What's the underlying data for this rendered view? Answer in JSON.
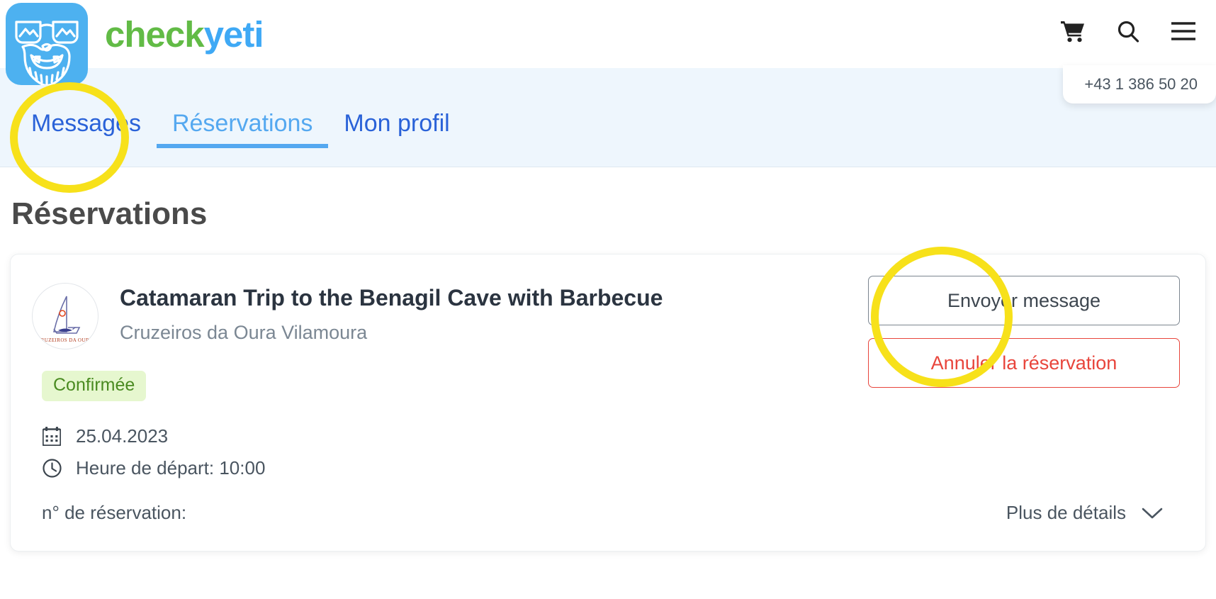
{
  "brand": {
    "name_part_green": "check",
    "name_part_blue": "yeti",
    "logo_icon": "yeti-logo-icon",
    "color_green": "#62bb46",
    "color_blue": "#3fa9f5",
    "logo_bg": "#4db1f0"
  },
  "header": {
    "cart_icon": "shopping-cart-icon",
    "search_icon": "search-icon",
    "menu_icon": "hamburger-menu-icon",
    "phone": "+43 1 386 50 20"
  },
  "tabs": [
    {
      "label": "Messages",
      "active": false
    },
    {
      "label": "Réservations",
      "active": true
    },
    {
      "label": "Mon profil",
      "active": false
    }
  ],
  "main": {
    "page_title": "Réservations",
    "booking": {
      "avatar_icon": "sailboat-logo-icon",
      "title": "Catamaran Trip to the Benagil Cave with Barbecue",
      "supplier": "Cruzeiros da Oura Vilamoura",
      "status_badge": "Confirmée",
      "status_badge_bg": "#e6f7cf",
      "status_badge_color": "#4a8b21",
      "date_icon": "calendar-icon",
      "date": "25.04.2023",
      "time_icon": "clock-icon",
      "time": "Heure de départ: 10:00",
      "reservation_number_label": "n° de réservation:",
      "more_details_label": "Plus de détails",
      "more_details_icon": "chevron-down-icon",
      "send_message_label": "Envoyer message",
      "cancel_label": "Annuler la réservation",
      "cancel_color": "#e8453c"
    }
  },
  "annotations": {
    "circle_color": "#f7e11a",
    "targets": [
      "Messages",
      "Envoyer message"
    ]
  }
}
